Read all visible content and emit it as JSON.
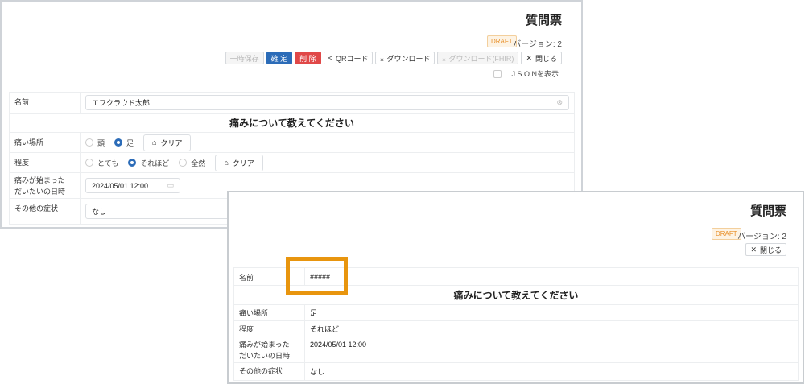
{
  "editor": {
    "title": "質問票",
    "status_badge": "DRAFT",
    "version": "バージョン: 2",
    "toolbar": {
      "temp_save": "一時保存",
      "confirm": "確 定",
      "delete": "削 除",
      "qr": "QRコード",
      "download": "ダウンロード",
      "download_fhir": "ダウンロード(FHIR)",
      "close": "閉じる"
    },
    "show_json_label": "J S O Nを表示",
    "form": {
      "name_label": "名前",
      "name_value": "エフクラウド太郎",
      "section_heading": "痛みについて教えてください",
      "pain_location": {
        "label": "痛い場所",
        "options": [
          "頭",
          "足"
        ],
        "selected": "足"
      },
      "severity": {
        "label": "程度",
        "options": [
          "とても",
          "それほど",
          "全然"
        ],
        "selected": "それほど"
      },
      "clear_label": "クリア",
      "onset": {
        "label": "痛みが始まった\nだいたいの日時",
        "value": "2024/05/01 12:00"
      },
      "other": {
        "label": "その他の症状",
        "value": "なし"
      }
    }
  },
  "viewer": {
    "title": "質問票",
    "status_badge": "DRAFT",
    "version": "バージョン: 2",
    "close": "閉じる",
    "rows": {
      "name": {
        "label": "名前",
        "value": "#####"
      },
      "section_heading": "痛みについて教えてください",
      "pain_location": {
        "label": "痛い場所",
        "value": "足"
      },
      "severity": {
        "label": "程度",
        "value": "それほど"
      },
      "onset": {
        "label": "痛みが始まった\nだいたいの日時",
        "value": "2024/05/01 12:00"
      },
      "other": {
        "label": "その他の症状",
        "value": "なし"
      }
    }
  },
  "colors": {
    "primary": "#2c6cb8",
    "danger": "#e04848",
    "highlight": "#e8950e",
    "draft": "#e8902a"
  }
}
